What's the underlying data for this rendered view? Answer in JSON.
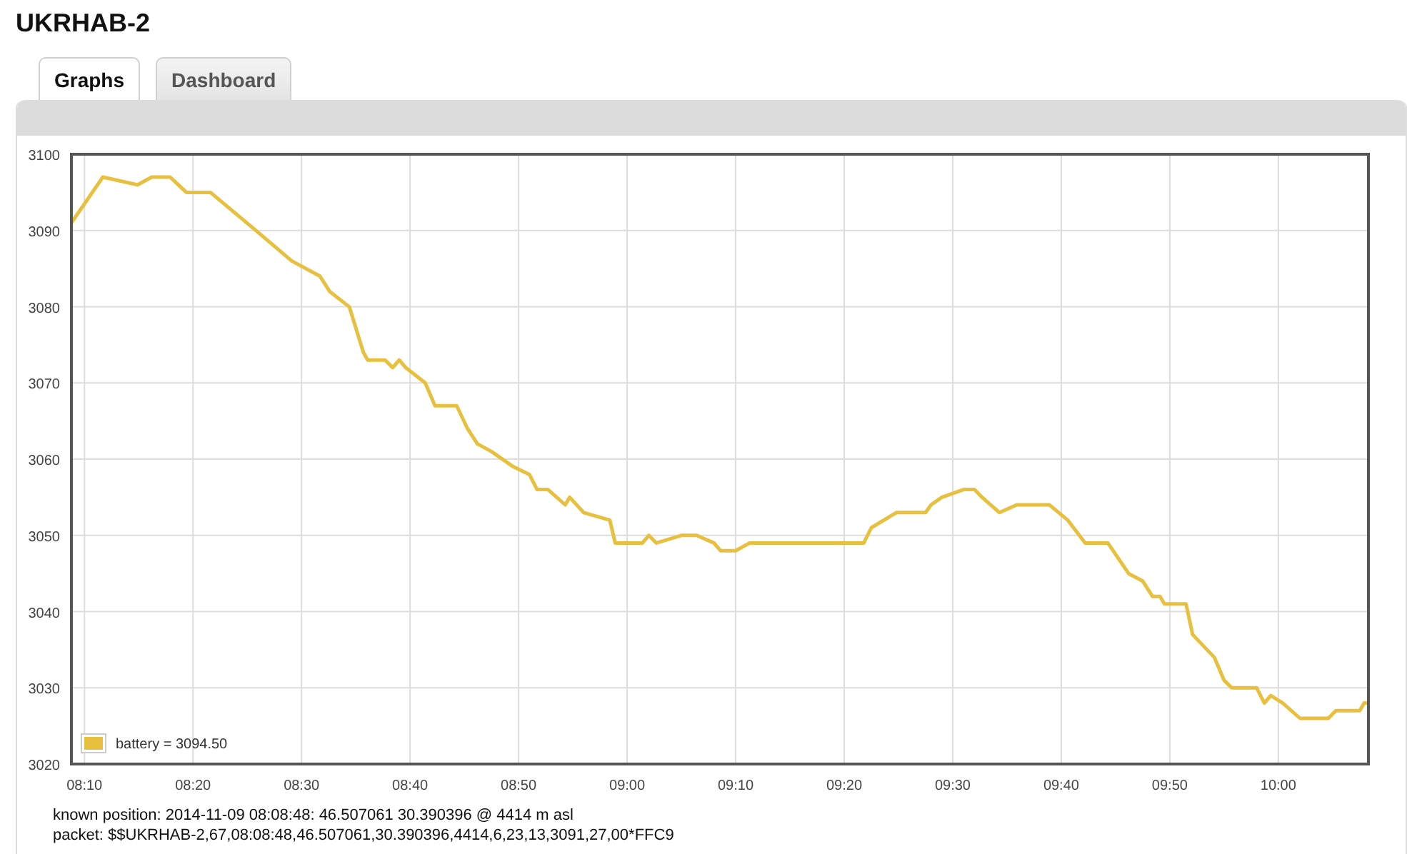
{
  "title": "UKRHAB-2",
  "tabs": [
    {
      "label": "Graphs",
      "selected": true
    },
    {
      "label": "Dashboard",
      "selected": false
    }
  ],
  "graph": {
    "legend_value": "= 3094.50",
    "chart_data": {
      "type": "line",
      "grid": true,
      "xlim": [
        488.8,
        608.3
      ],
      "ylim": [
        3020,
        3100
      ],
      "x": [
        488.8,
        491.7,
        494.9,
        496.2,
        497.9,
        499.4,
        501.6,
        505.8,
        509.1,
        511.7,
        512.6,
        514.4,
        515.7,
        516.1,
        517.7,
        518.4,
        519,
        519.6,
        521.4,
        522.3,
        524.3,
        525.3,
        526.2,
        527.5,
        529.5,
        531,
        531.7,
        532.7,
        534.3,
        534.7,
        536,
        538.4,
        538.9,
        541.4,
        542,
        542.7,
        545,
        546.4,
        548,
        548.6,
        550,
        551.3,
        561.8,
        562.5,
        564.8,
        567.5,
        568,
        569,
        571,
        572,
        572.7,
        574.3,
        575.9,
        577.2,
        578.9,
        580.6,
        582.2,
        584.3,
        586.2,
        587.5,
        588.4,
        589.1,
        589.5,
        591.5,
        592.1,
        594.1,
        595,
        595.7,
        598,
        598.7,
        599.3,
        600.4,
        602,
        604.6,
        605.3,
        607.5,
        607.9,
        608.3
      ],
      "series": [
        {
          "name": "battery",
          "color": "#e8c040",
          "values": [
            3091,
            3097,
            3096,
            3097,
            3097,
            3095,
            3095,
            3090,
            3086,
            3084,
            3082,
            3080,
            3074,
            3073,
            3073,
            3072,
            3073,
            3072,
            3070,
            3067,
            3067,
            3064,
            3062,
            3061,
            3059,
            3058,
            3056,
            3056,
            3054,
            3055,
            3053,
            3052,
            3049,
            3049,
            3050,
            3049,
            3050,
            3050,
            3049,
            3048,
            3048,
            3049,
            3049,
            3051,
            3053,
            3053,
            3054,
            3055,
            3056,
            3056,
            3055,
            3053,
            3054,
            3054,
            3054,
            3052,
            3049,
            3049,
            3045,
            3044,
            3042,
            3042,
            3041,
            3041,
            3037,
            3034,
            3031,
            3030,
            3030,
            3028,
            3029,
            3028,
            3026,
            3026,
            3027,
            3027,
            3028,
            3028
          ]
        }
      ],
      "xticks": [
        {
          "value": 490,
          "label": "08:10"
        },
        {
          "value": 500,
          "label": "08:20"
        },
        {
          "value": 510,
          "label": "08:30"
        },
        {
          "value": 520,
          "label": "08:40"
        },
        {
          "value": 530,
          "label": "08:50"
        },
        {
          "value": 540,
          "label": "09:00"
        },
        {
          "value": 550,
          "label": "09:10"
        },
        {
          "value": 560,
          "label": "09:20"
        },
        {
          "value": 570,
          "label": "09:30"
        },
        {
          "value": 580,
          "label": "09:40"
        },
        {
          "value": 590,
          "label": "09:50"
        },
        {
          "value": 600,
          "label": "10:00"
        }
      ],
      "yticks": [
        3020,
        3030,
        3040,
        3050,
        3060,
        3070,
        3080,
        3090,
        3100
      ]
    }
  },
  "info": [
    "known position: 2014-11-09 08:08:48: 46.507061 30.390396 @ 4414 m asl",
    "packet: $$UKRHAB-2,67,08:08:48,46.507061,30.390396,4414,6,23,13,3091,27,00*FFC9"
  ]
}
